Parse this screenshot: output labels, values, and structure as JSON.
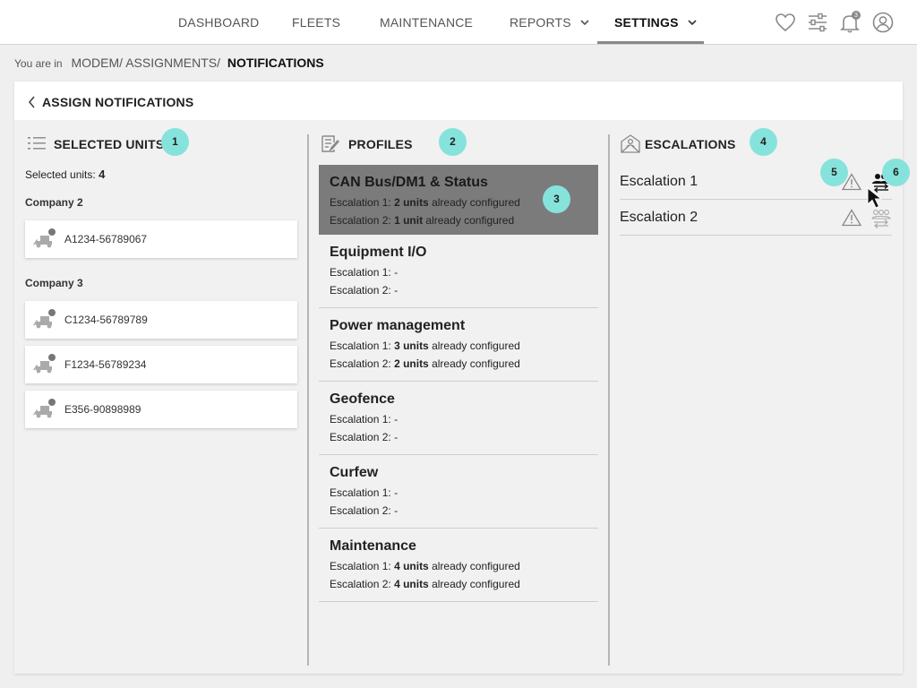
{
  "nav": {
    "items": [
      {
        "label": "DASHBOARD"
      },
      {
        "label": "FLEETS"
      },
      {
        "label": "MAINTENANCE"
      },
      {
        "label": "REPORTS"
      },
      {
        "label": "SETTINGS"
      }
    ],
    "notification_count": "3"
  },
  "breadcrumb": {
    "prefix": "You are in",
    "crumbs": [
      "MODEM/",
      "ASSIGNMENTS/"
    ],
    "current": "NOTIFICATIONS"
  },
  "page": {
    "title": "ASSIGN NOTIFICATIONS"
  },
  "units": {
    "heading": "SELECTED UNITS",
    "count_label": "Selected units:",
    "count": "4",
    "companies": [
      {
        "name": "Company 2",
        "units": [
          "A1234-56789067"
        ]
      },
      {
        "name": "Company 3",
        "units": [
          "C1234-56789789",
          "F1234-56789234",
          "E356-90898989"
        ]
      }
    ]
  },
  "profiles": {
    "heading": "PROFILES",
    "items": [
      {
        "name": "CAN Bus/DM1 & Status",
        "lines": [
          {
            "label": "Escalation 1:",
            "value": "2 units",
            "suffix": "already configured"
          },
          {
            "label": "Escalation 2:",
            "value": "1 unit",
            "suffix": "already configured"
          }
        ]
      },
      {
        "name": "Equipment I/O",
        "lines": [
          {
            "label": "Escalation 1:",
            "value": "-",
            "suffix": ""
          },
          {
            "label": "Escalation 2:",
            "value": "-",
            "suffix": ""
          }
        ]
      },
      {
        "name": "Power management",
        "lines": [
          {
            "label": "Escalation 1:",
            "value": "3 units",
            "suffix": "already configured"
          },
          {
            "label": "Escalation 2:",
            "value": "2 units",
            "suffix": "already configured"
          }
        ]
      },
      {
        "name": "Geofence",
        "lines": [
          {
            "label": "Escalation 1:",
            "value": "-",
            "suffix": ""
          },
          {
            "label": "Escalation 2:",
            "value": "-",
            "suffix": ""
          }
        ]
      },
      {
        "name": "Curfew",
        "lines": [
          {
            "label": "Escalation 1:",
            "value": "-",
            "suffix": ""
          },
          {
            "label": "Escalation 2:",
            "value": "-",
            "suffix": ""
          }
        ]
      },
      {
        "name": "Maintenance",
        "lines": [
          {
            "label": "Escalation 1:",
            "value": "4 units",
            "suffix": "already configured"
          },
          {
            "label": "Escalation 2:",
            "value": "4 units",
            "suffix": "already configured"
          }
        ]
      }
    ]
  },
  "escalations": {
    "heading": "ESCALATIONS",
    "items": [
      {
        "name": "Escalation 1"
      },
      {
        "name": "Escalation 2"
      }
    ]
  },
  "badges": [
    "1",
    "2",
    "3",
    "4",
    "5",
    "6"
  ],
  "icons": [
    "heart-icon",
    "sliders-icon",
    "bell-icon",
    "user-icon",
    "list-icon",
    "edit-doc-icon",
    "envelope-user-icon",
    "warning-icon",
    "assign-group-icon",
    "unit-icon",
    "chevron-left-icon",
    "chevron-down-icon",
    "cursor-icon"
  ],
  "colors": {
    "badge": "#86e3dc",
    "selected_profile": "#7b7b7b",
    "background": "#efefef"
  }
}
